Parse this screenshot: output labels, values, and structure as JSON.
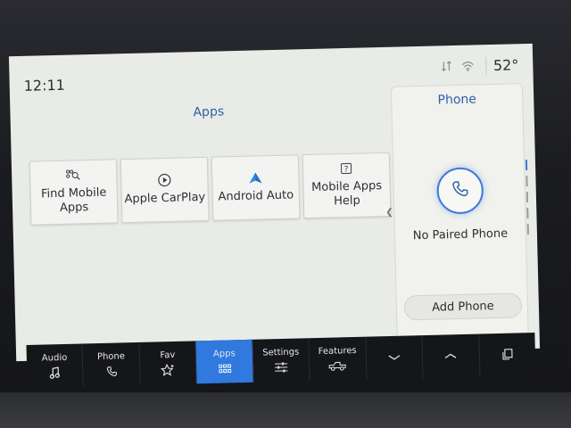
{
  "status": {
    "time": "12:11",
    "temperature": "52°"
  },
  "apps": {
    "title": "Apps",
    "tiles": [
      {
        "label": "Find Mobile Apps",
        "icon": "find-apps-icon"
      },
      {
        "label": "Apple CarPlay",
        "icon": "carplay-icon"
      },
      {
        "label": "Android Auto",
        "icon": "android-auto-icon"
      },
      {
        "label": "Mobile Apps Help",
        "icon": "help-icon"
      }
    ]
  },
  "phone": {
    "title": "Phone",
    "status": "No Paired Phone",
    "add_label": "Add Phone"
  },
  "nav": {
    "items": [
      {
        "label": "Audio",
        "icon": "music-note-icon"
      },
      {
        "label": "Phone",
        "icon": "phone-icon"
      },
      {
        "label": "Fav",
        "icon": "star-icon"
      },
      {
        "label": "Apps",
        "icon": "apps-grid-icon"
      },
      {
        "label": "Settings",
        "icon": "sliders-icon"
      },
      {
        "label": "Features",
        "icon": "truck-icon"
      }
    ]
  },
  "colors": {
    "accent": "#2f79df",
    "title_blue": "#2e5ea8",
    "screen_bg": "#e9ebe6"
  }
}
